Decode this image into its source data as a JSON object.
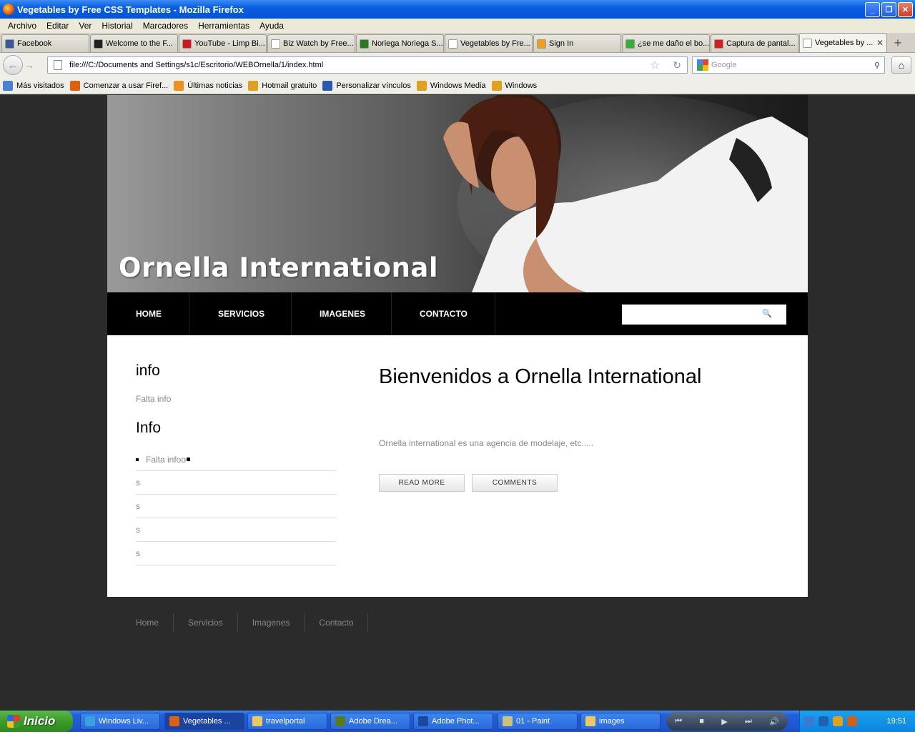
{
  "window": {
    "title": "Vegetables by Free CSS Templates - Mozilla Firefox"
  },
  "menu": [
    "Archivo",
    "Editar",
    "Ver",
    "Historial",
    "Marcadores",
    "Herramientas",
    "Ayuda"
  ],
  "tabs": [
    {
      "label": "Facebook",
      "icon_color": "#3b5998"
    },
    {
      "label": "Welcome to the F...",
      "icon_color": "#222"
    },
    {
      "label": "YouTube - Limp Bi...",
      "icon_color": "#cc181e"
    },
    {
      "label": "Biz Watch by Free...",
      "icon_color": "#ffffff"
    },
    {
      "label": "Noriega Noriega S...",
      "icon_color": "#2a7a20"
    },
    {
      "label": "Vegetables by Fre...",
      "icon_color": "#ffffff"
    },
    {
      "label": "Sign In",
      "icon_color": "#f0a020"
    },
    {
      "label": "¿se me daño el bo...",
      "icon_color": "#3aaa3a"
    },
    {
      "label": "Captura de pantal...",
      "icon_color": "#d02020"
    },
    {
      "label": "Vegetables by ...",
      "icon_color": "#ffffff",
      "active": true
    }
  ],
  "nav": {
    "url": "file:///C:/Documents and Settings/s1c/Escritorio/WEBOrnella/1/index.html",
    "search_placeholder": "Google"
  },
  "bookmarks": [
    {
      "label": "Más visitados",
      "icon_color": "#4a80d0"
    },
    {
      "label": "Comenzar a usar Firef...",
      "icon_color": "#e06010"
    },
    {
      "label": "Últimas noticias",
      "icon_color": "#f09020"
    },
    {
      "label": "Hotmail gratuito",
      "icon_color": "#e0a020"
    },
    {
      "label": "Personalizar vínculos",
      "icon_color": "#2a5ab0"
    },
    {
      "label": "Windows Media",
      "icon_color": "#e0a020"
    },
    {
      "label": "Windows",
      "icon_color": "#e0a020"
    }
  ],
  "site": {
    "title": "Ornella International",
    "menu": [
      "HOME",
      "SERVICIOS",
      "IMAGENES",
      "CONTACTO"
    ],
    "sidebar": {
      "h1": "info",
      "text1": "Falta info",
      "h2": "Info",
      "list": [
        "Falta infoo",
        "s",
        "s",
        "s",
        "s"
      ]
    },
    "main": {
      "title": "Bienvenidos a Ornella International",
      "text": "Ornella international es una agencia de modelaje, etc.....",
      "read_more": "READ MORE",
      "comments": "COMMENTS"
    },
    "footer": [
      "Home",
      "Servicios",
      "Imagenes",
      "Contacto"
    ]
  },
  "taskbar": {
    "start": "Inicio",
    "items": [
      {
        "label": "Windows Liv...",
        "icon_color": "#3aa0e0"
      },
      {
        "label": "Vegetables ...",
        "icon_color": "#e06010",
        "active": true
      },
      {
        "label": "travelportal",
        "icon_color": "#f0c860"
      },
      {
        "label": "Adobe Drea...",
        "icon_color": "#5a7a20"
      },
      {
        "label": "Adobe Phot...",
        "icon_color": "#1a4aa0"
      },
      {
        "label": "01 - Paint",
        "icon_color": "#d0c080"
      },
      {
        "label": "images",
        "icon_color": "#f0c860"
      }
    ],
    "clock": "19:51"
  }
}
